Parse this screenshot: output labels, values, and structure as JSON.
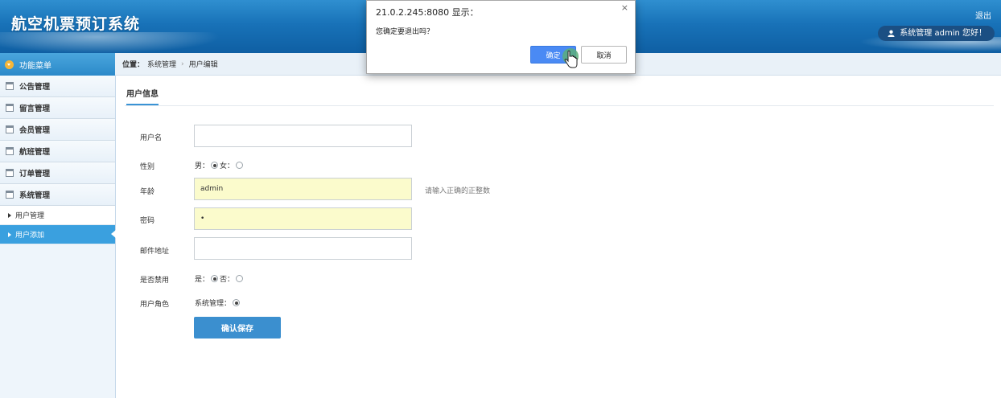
{
  "header": {
    "app_title": "航空机票预订系统",
    "logout": "退出",
    "user_greeting": "系统管理 admin 您好！"
  },
  "sidebar": {
    "menu_title": "功能菜单",
    "items": [
      {
        "label": "公告管理",
        "icon": "calendar-icon"
      },
      {
        "label": "留言管理",
        "icon": "calendar-icon"
      },
      {
        "label": "会员管理",
        "icon": "calendar-icon"
      },
      {
        "label": "航班管理",
        "icon": "calendar-icon"
      },
      {
        "label": "订单管理",
        "icon": "calendar-icon"
      },
      {
        "label": "系统管理",
        "icon": "calendar-icon"
      }
    ],
    "sub_items": [
      {
        "label": "用户管理",
        "active": false
      },
      {
        "label": "用户添加",
        "active": true
      }
    ]
  },
  "breadcrumb": {
    "location_label": "位置：",
    "crumbs": [
      "系统管理",
      "用户编辑"
    ]
  },
  "section": {
    "tab": "用户信息"
  },
  "form": {
    "username": {
      "label": "用户名",
      "value": ""
    },
    "gender": {
      "label": "性别",
      "male": "男：",
      "female": "女：",
      "selected": "male"
    },
    "age": {
      "label": "年龄",
      "value": "admin",
      "hint": "请输入正确的正整数"
    },
    "password": {
      "label": "密码",
      "value": "•"
    },
    "email": {
      "label": "邮件地址",
      "value": ""
    },
    "disabled": {
      "label": "是否禁用",
      "yes": "是：",
      "no": "否：",
      "selected": "yes"
    },
    "role": {
      "label": "用户角色",
      "option": "系统管理："
    },
    "save_button": "确认保存"
  },
  "dialog": {
    "title": "21.0.2.245:8080 显示：",
    "message": "您确定要退出吗？",
    "ok": "确定",
    "cancel": "取消",
    "close": "×"
  },
  "colors": {
    "header": "#1872b8",
    "accent": "#3aa0df",
    "button": "#3b8fcf",
    "input_filled": "#fbfbcc"
  }
}
